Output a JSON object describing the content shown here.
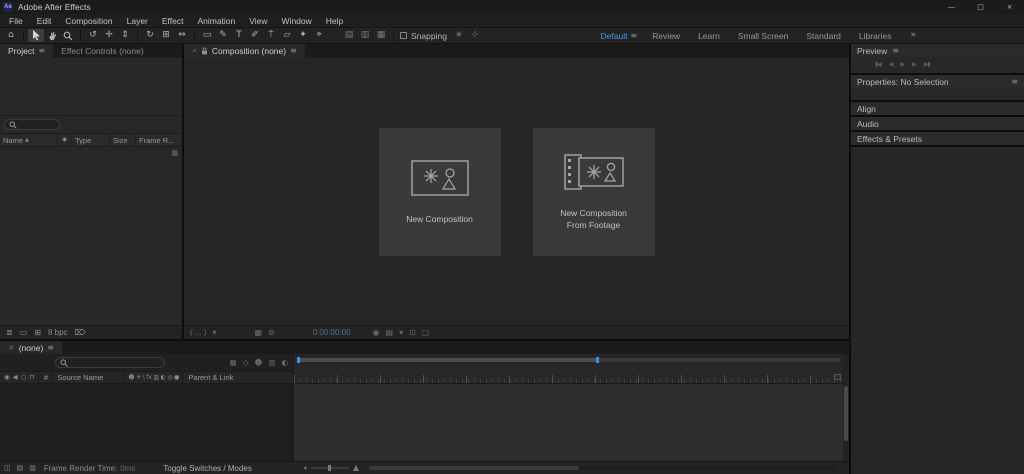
{
  "titlebar": {
    "app_initials": "Ae",
    "title": "Adobe After Effects"
  },
  "menubar": {
    "items": [
      "File",
      "Edit",
      "Composition",
      "Layer",
      "Effect",
      "Animation",
      "View",
      "Window",
      "Help"
    ]
  },
  "toolbar": {
    "snapping_label": "Snapping",
    "workspaces": {
      "active": "Default",
      "items": [
        "Review",
        "Learn",
        "Small Screen",
        "Standard",
        "Libraries"
      ]
    }
  },
  "project": {
    "tab": "Project",
    "tab_effect_controls": "Effect Controls (none)",
    "columns": [
      "Name",
      "Type",
      "Size",
      "Frame R..."
    ],
    "bpc": "8 bpc"
  },
  "composition": {
    "tab": "Composition (none)",
    "new_comp": "New Composition",
    "new_from_footage_1": "New Composition",
    "new_from_footage_2": "From Footage",
    "zoom": "( ... )",
    "timecode": "0:00:00:00"
  },
  "right": {
    "preview": "Preview",
    "properties": "Properties: No Selection",
    "align": "Align",
    "audio": "Audio",
    "effects": "Effects & Presets"
  },
  "timeline": {
    "tab": "(none)",
    "hash": "#",
    "source_name": "Source Name",
    "parent_link": "Parent & Link"
  },
  "bottom": {
    "frame_render": "Frame Render Time:",
    "frame_render_value": "0ms",
    "toggle": "Toggle Switches / Modes"
  },
  "colors": {
    "accent": "#3f8fe8",
    "timecode_blue": "#50709a",
    "panel": "#282828"
  },
  "icons": {
    "minimize": "—",
    "maximize": "□",
    "close": "×",
    "menu": "≡",
    "chevron_left": "«",
    "chevron_right": "»",
    "home": "⌂",
    "orbit": "↺",
    "pan": "✛",
    "dolly": "⇕",
    "rotate": "↻",
    "camera": "⊞",
    "pan_behind": "⇔",
    "shape": "▭",
    "pen": "✎",
    "type_tool": "T",
    "brush": "✐",
    "clone_stamp": "⍑",
    "eraser": "▱",
    "roto_brush": "✦",
    "puppet": "⌖",
    "mask_opt1": "▤",
    "mask_opt2": "▥",
    "mask_opt3": "▦",
    "snap_a": "∗",
    "snap_b": "⊹",
    "sort_asc": "▲",
    "label_col": "◆",
    "interpret": "≣",
    "new_folder": "▭",
    "new_comp": "⊞",
    "trash": "⌦",
    "caret_down": "▾",
    "grid": "▦",
    "mask_vis": "⊚",
    "snapshot": "◉",
    "channels": "▤",
    "roi": "⊡",
    "transparency": "▢",
    "tr_start": "▮◀",
    "tr_prev": "◀",
    "tr_play": "▶",
    "tr_next": "▶",
    "tr_end": "▶▮",
    "eye": "◉",
    "speaker": "◀",
    "solo": "○",
    "lock_col": "⊓",
    "shy": "☻",
    "collapse": "✳",
    "quality": "\\",
    "fx": "fx",
    "frame_blend": "▥",
    "motion_blur": "◐",
    "adjustment": "◎",
    "threed": "●",
    "mini_flowchart": "▦",
    "draft_3d": "◇",
    "zoom_out": "▴",
    "zoom_in": "▲",
    "bb1": "◫",
    "bb2": "▤",
    "bb3": "▥"
  }
}
